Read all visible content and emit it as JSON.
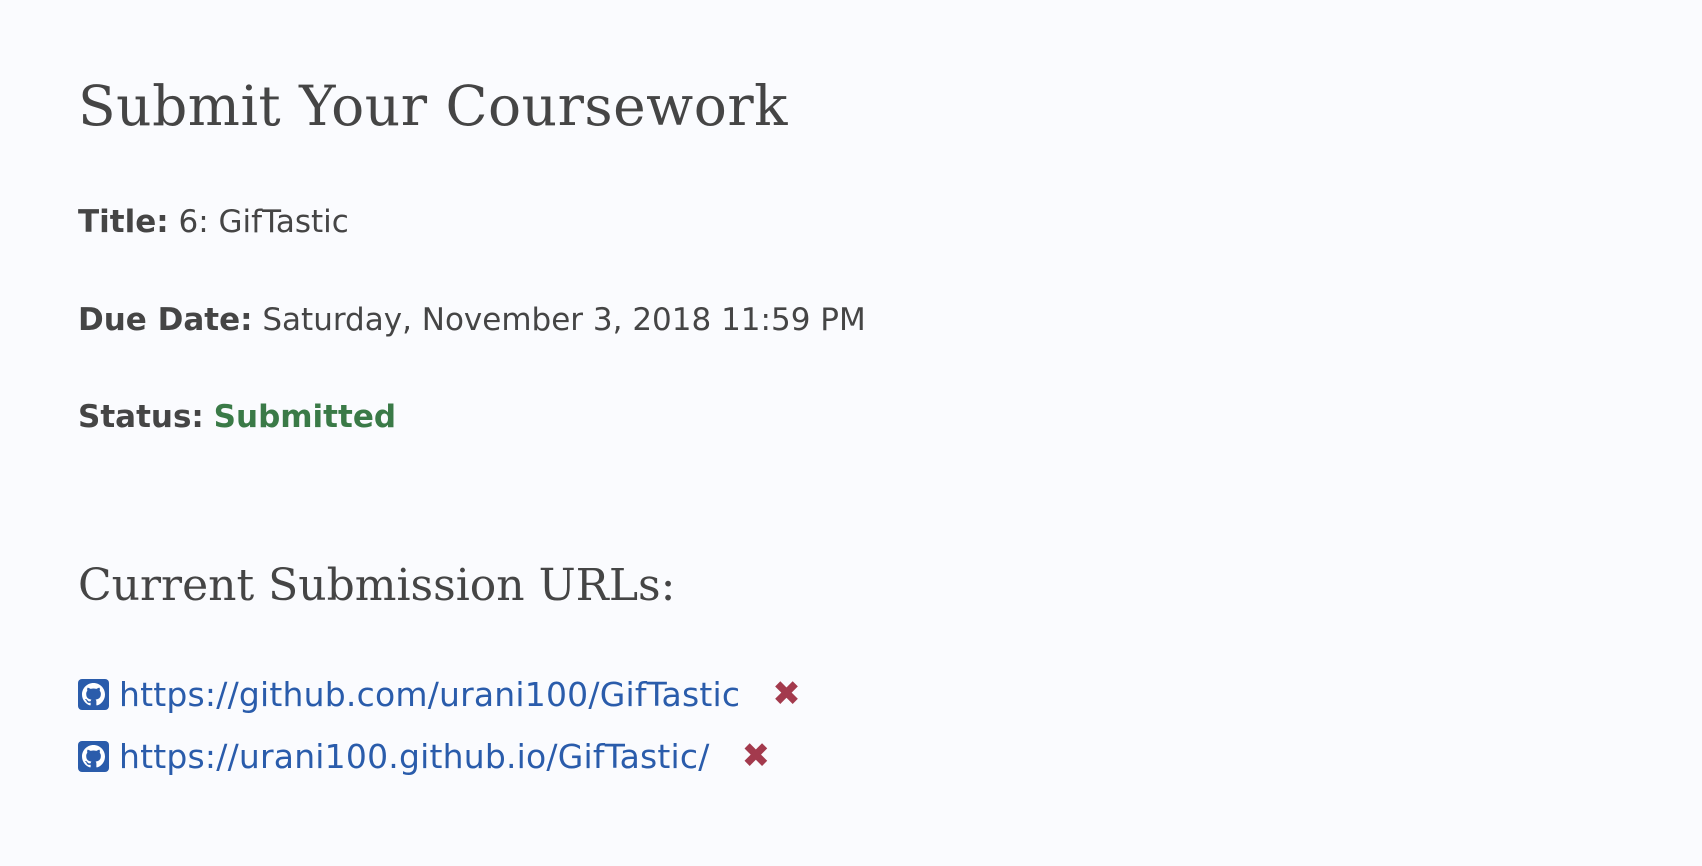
{
  "page": {
    "heading": "Submit Your Coursework"
  },
  "details": {
    "title_label": "Title:",
    "title_value": "6: GifTastic",
    "due_label": "Due Date:",
    "due_value": "Saturday, November 3, 2018 11:59 PM",
    "status_label": "Status:",
    "status_value": "Submitted"
  },
  "submissions": {
    "heading": "Current Submission URLs:",
    "urls": [
      {
        "url": "https://github.com/urani100/GifTastic",
        "icon": "github-icon",
        "remove_glyph": "✖"
      },
      {
        "url": "https://urani100.github.io/GifTastic/",
        "icon": "github-icon",
        "remove_glyph": "✖"
      }
    ]
  },
  "colors": {
    "status_submitted": "#3a7a47",
    "link": "#2a5cab",
    "remove": "#a33a4d",
    "text": "#454545",
    "background": "#fafbfe"
  }
}
